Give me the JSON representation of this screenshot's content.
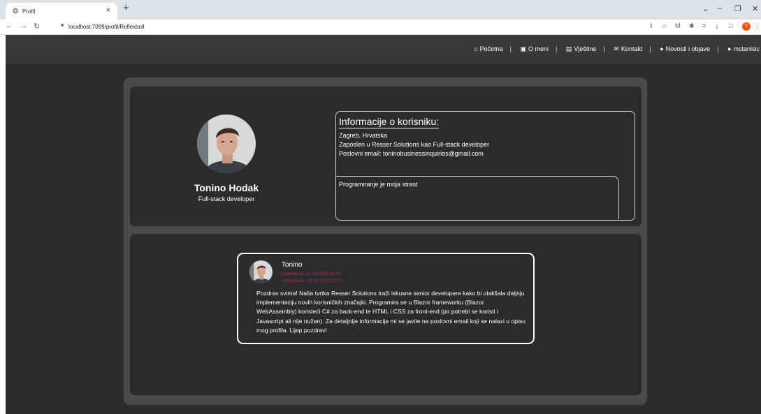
{
  "browser": {
    "tab_title": "Profil",
    "url": "localhost:7099/profil/Reflexbull",
    "profile_initial": "T"
  },
  "nav": {
    "items": [
      {
        "label": "Početna",
        "icon": "home-icon"
      },
      {
        "label": "O meni",
        "icon": "id-card-icon"
      },
      {
        "label": "Vještine",
        "icon": "book-icon"
      },
      {
        "label": "Kontakt",
        "icon": "envelope-icon"
      },
      {
        "label": "Novosti i objave",
        "icon": "comments-icon"
      },
      {
        "label": "mstanisic",
        "icon": "user-icon"
      }
    ],
    "separator": "|"
  },
  "profile": {
    "name": "Tonino Hodak",
    "role": "Full-stack developer"
  },
  "info": {
    "title": "Informacije o korisniku:",
    "location": "Zagreb, Hrvatska",
    "employment": "Zaposlen u Resser Solutions kao Full-stack developer",
    "email": "Poslovni email: toninobusinessinquiries@gmail.com",
    "bio": "Programiranje je moja strast"
  },
  "post": {
    "author": "Tonino",
    "published": "Objavljeno: 13.09.2023 04:53",
    "edited": "Izmijenjeno: 13.09.2023 13:27",
    "body": "Pozdrav svima! Naša tvrtka Resser Solutions traži iskusne senior developere kako bi olakšala daljnju implementaciju novih korisničkih značajki. Programira se u Blazor frameworku (Blazor WebAssembly) koristeći C# za back-end te HTML i CSS za front-end (po potrebi se koristi i Javascript ali nije nužan). Za detaljnije informacije mi se javite na poslovni email koji se nalazi u opisu mog profila. Lijep pozdrav!"
  },
  "colors": {
    "page_bg": "#2b2b2b",
    "outer_container": "#4a4a4a",
    "meta_text": "#b02a6b"
  }
}
